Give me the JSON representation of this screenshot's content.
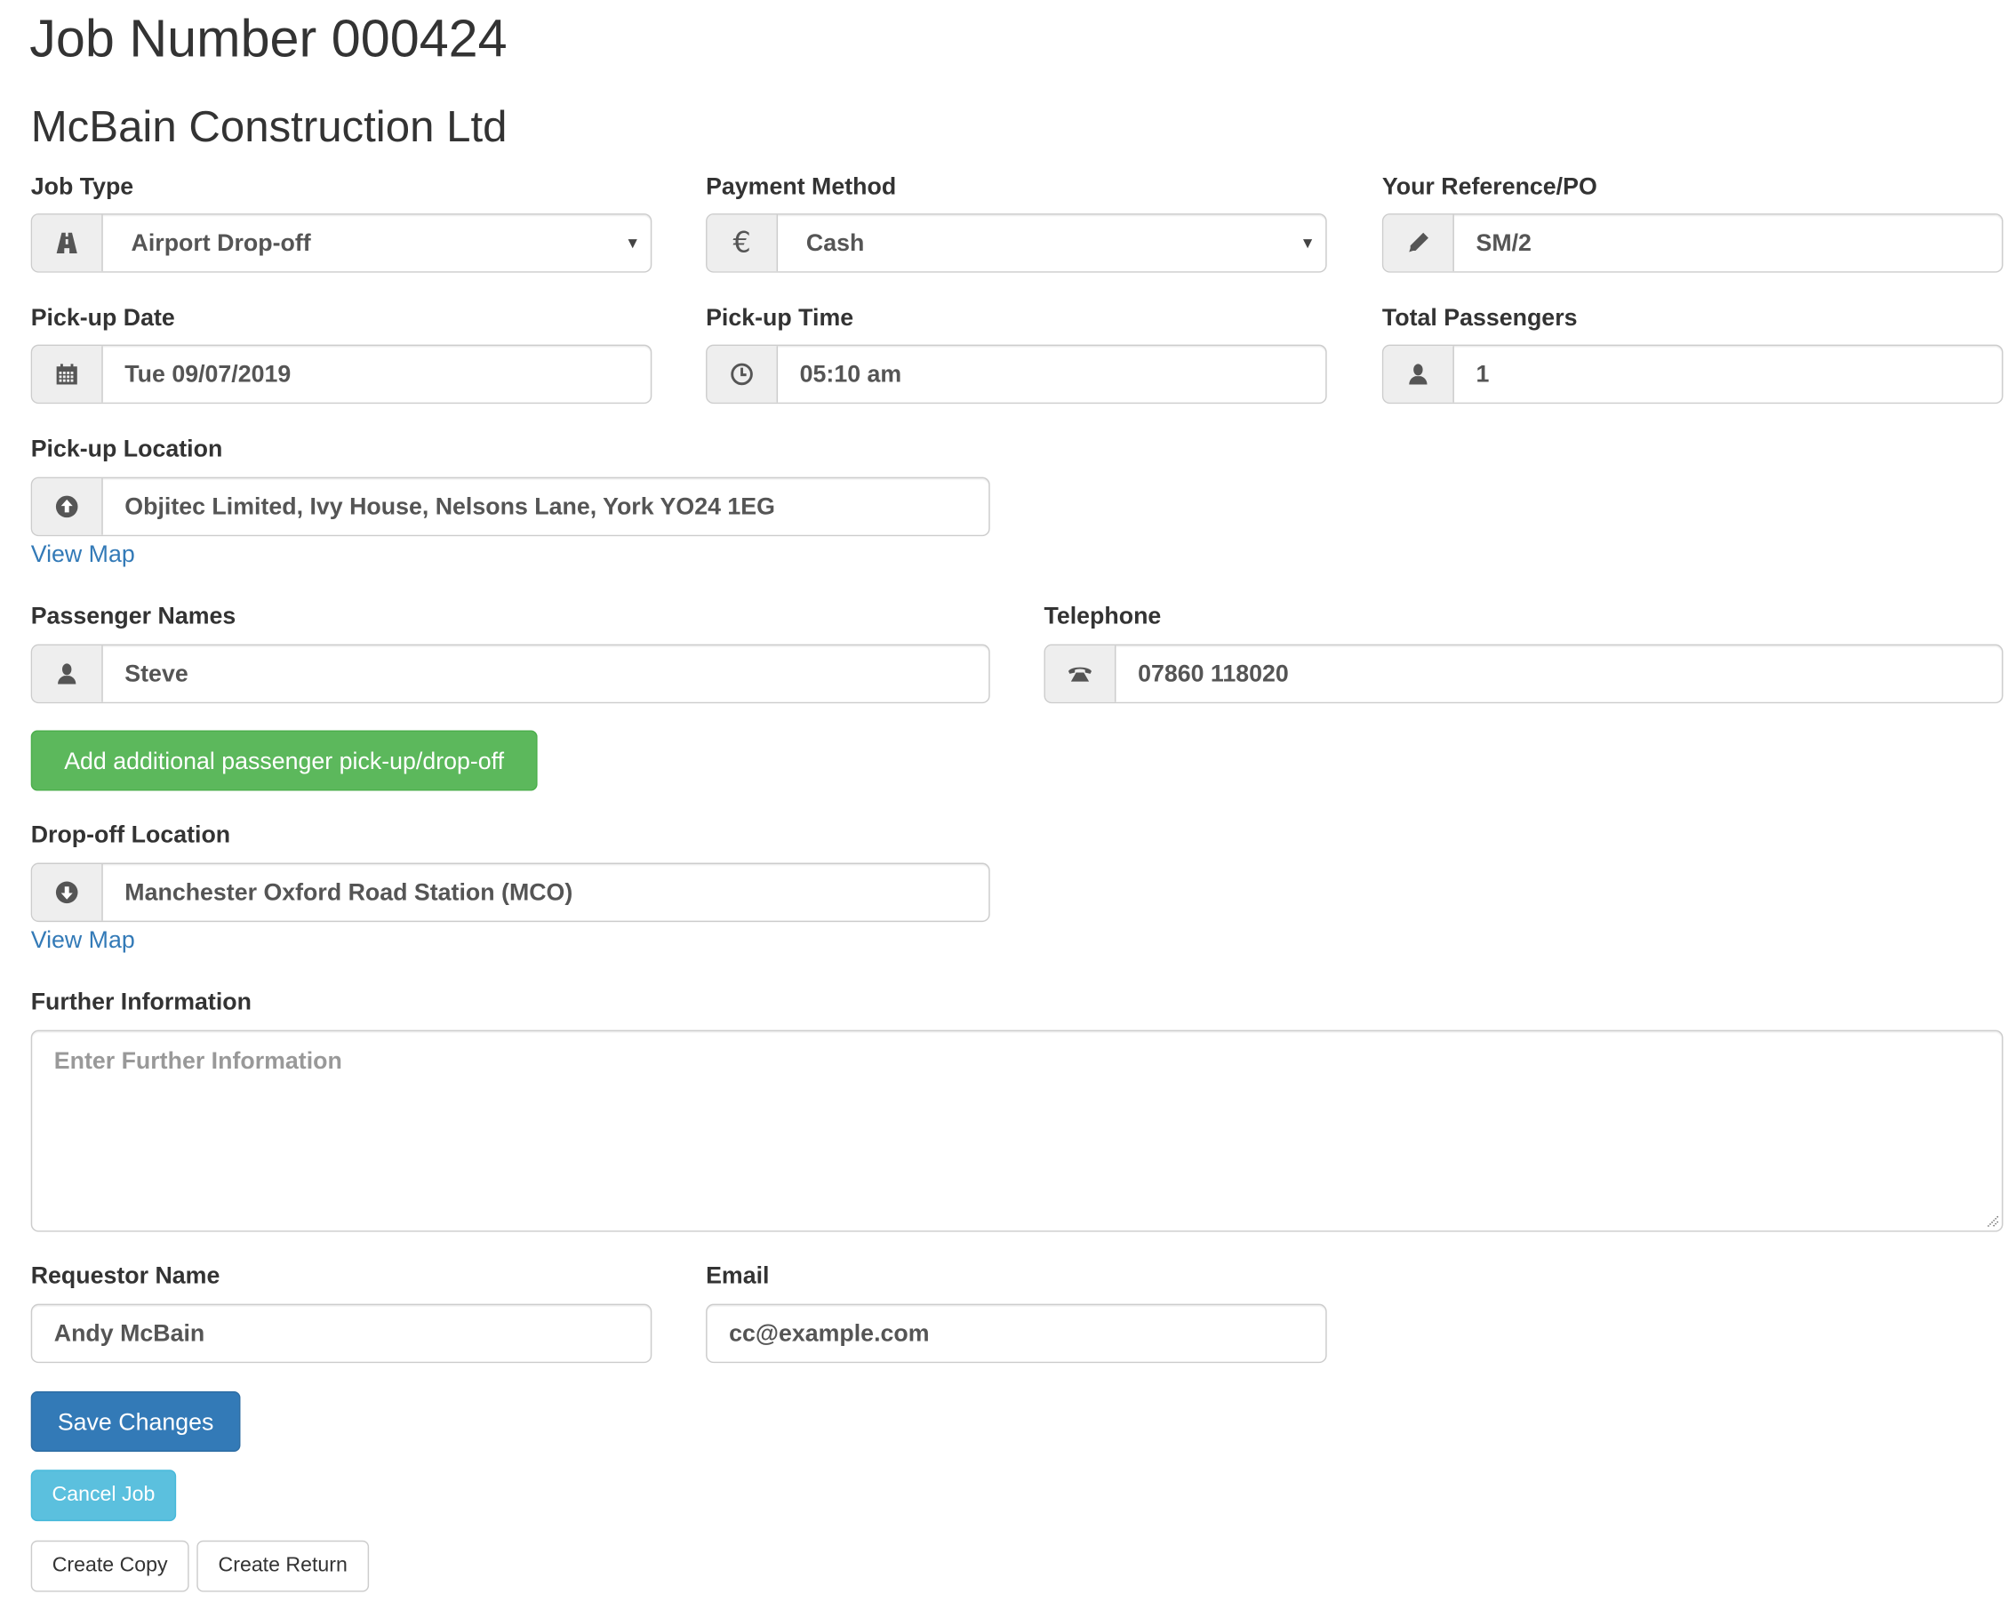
{
  "header": {
    "title": "Job Number 000424",
    "company": "McBain Construction Ltd"
  },
  "fields": {
    "job_type": {
      "label": "Job Type",
      "value": "Airport Drop-off",
      "icon": "road-icon"
    },
    "payment_method": {
      "label": "Payment Method",
      "value": "Cash",
      "icon": "euro-icon"
    },
    "reference": {
      "label": "Your Reference/PO",
      "value": "SM/2",
      "icon": "pencil-icon"
    },
    "pickup_date": {
      "label": "Pick-up Date",
      "value": "Tue 09/07/2019",
      "icon": "calendar-icon"
    },
    "pickup_time": {
      "label": "Pick-up Time",
      "value": "05:10 am",
      "icon": "clock-icon"
    },
    "total_passengers": {
      "label": "Total Passengers",
      "value": "1",
      "icon": "user-icon"
    },
    "pickup_location": {
      "label": "Pick-up Location",
      "value": "Objitec Limited, Ivy House, Nelsons Lane, York YO24 1EG",
      "icon": "circle-arrow-up-icon",
      "map_link": "View Map"
    },
    "passenger_names": {
      "label": "Passenger Names",
      "value": "Steve",
      "icon": "user-icon"
    },
    "telephone": {
      "label": "Telephone",
      "value": "07860 118020",
      "icon": "phone-icon"
    },
    "dropoff_location": {
      "label": "Drop-off Location",
      "value": "Manchester Oxford Road Station (MCO)",
      "icon": "circle-arrow-down-icon",
      "map_link": "View Map"
    },
    "further_info": {
      "label": "Further Information",
      "value": "",
      "placeholder": "Enter Further Information"
    },
    "requestor_name": {
      "label": "Requestor Name",
      "value": "Andy McBain"
    },
    "email": {
      "label": "Email",
      "value": "cc@example.com"
    }
  },
  "buttons": {
    "add_passenger": "Add additional passenger pick-up/drop-off",
    "save": "Save Changes",
    "cancel_job": "Cancel Job",
    "create_copy": "Create Copy",
    "create_return": "Create Return"
  },
  "colors": {
    "link": "#337ab7",
    "success": "#5cb85c",
    "primary": "#337ab7",
    "info": "#5bc0de"
  }
}
